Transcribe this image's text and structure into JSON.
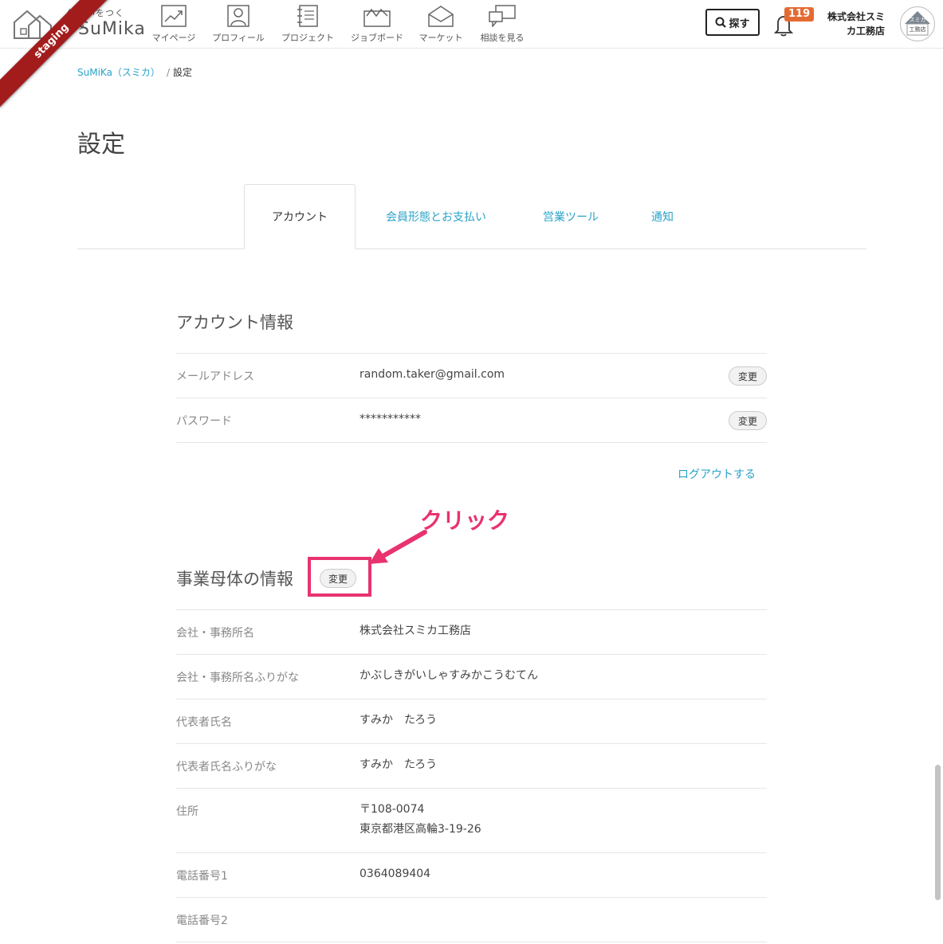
{
  "header": {
    "logo": {
      "tagline": "住まいをつくろう",
      "wordmark": "SuMika"
    },
    "environment_ribbon": "staging",
    "nav": [
      {
        "label": "マイページ",
        "icon": "chart-trend-icon"
      },
      {
        "label": "プロフィール",
        "icon": "user-profile-icon"
      },
      {
        "label": "プロジェクト",
        "icon": "notebook-icon"
      },
      {
        "label": "ジョブボード",
        "icon": "jobboard-icon"
      },
      {
        "label": "マーケット",
        "icon": "market-icon"
      },
      {
        "label": "相談を見る",
        "icon": "chat-bubbles-icon"
      }
    ],
    "search_label": "探す",
    "notification_count": "119",
    "company_line1": "株式会社スミ",
    "company_line2": "カ工務店",
    "avatar_line1": "スミカ",
    "avatar_line2": "工務店"
  },
  "breadcrumb": {
    "home": "SuMiKa（スミカ）",
    "separator": "/",
    "current": "設定"
  },
  "page_title": "設定",
  "tabs": [
    {
      "label": "アカウント",
      "active": true
    },
    {
      "label": "会員形態とお支払い",
      "active": false
    },
    {
      "label": "営業ツール",
      "active": false
    },
    {
      "label": "通知",
      "active": false
    }
  ],
  "account": {
    "title": "アカウント情報",
    "rows": [
      {
        "label": "メールアドレス",
        "value": "random.taker@gmail.com",
        "button": "変更"
      },
      {
        "label": "パスワード",
        "value": "***********",
        "button": "変更"
      }
    ],
    "logout": "ログアウトする"
  },
  "business": {
    "title": "事業母体の情報",
    "edit_button": "変更",
    "rows": [
      {
        "label": "会社・事務所名",
        "value": "株式会社スミカ工務店"
      },
      {
        "label": "会社・事務所名ふりがな",
        "value": "かぶしきがいしゃすみかこうむてん"
      },
      {
        "label": "代表者氏名",
        "value": "すみか　たろう"
      },
      {
        "label": "代表者氏名ふりがな",
        "value": "すみか　たろう"
      },
      {
        "label": "住所",
        "value_line1": "〒108-0074",
        "value_line2": "東京都港区高輪3-19-26"
      },
      {
        "label": "電話番号1",
        "value": "0364089404"
      },
      {
        "label": "電話番号2",
        "value": ""
      }
    ]
  },
  "annotation": {
    "text": "クリック",
    "color": "#e8336f"
  },
  "colors": {
    "link": "#2aa3c8",
    "badge": "#e36b33",
    "ribbon": "#a31c1c"
  }
}
